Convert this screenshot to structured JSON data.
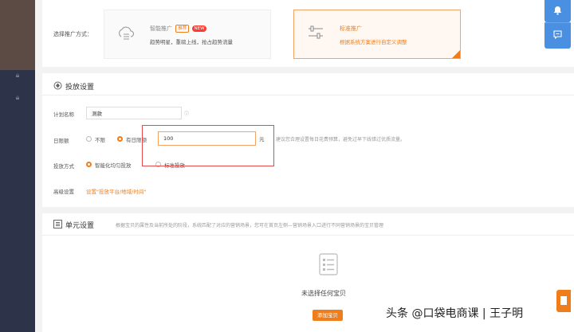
{
  "promotion": {
    "label": "选择推广方式：",
    "options": [
      {
        "title": "智能推广",
        "badge_recommend": "推荐",
        "badge_new": "NEW",
        "desc": "趋势明星，重磅上线，抢占趋势流量",
        "selected": false
      },
      {
        "title": "标准推广",
        "desc": "根据系统方案进行自定义调整",
        "selected": true
      }
    ]
  },
  "delivery": {
    "title": "投放设置",
    "plan_name_label": "计划名称",
    "plan_name_value": "测款",
    "daily_limit_label": "日限额",
    "no_limit_label": "不限",
    "has_limit_label": "有日限额",
    "daily_limit_value": "100",
    "unit": "元",
    "hint": "建议您合理设置每日花费预算，避免过早下线错过优质流量。",
    "method_label": "投放方式",
    "method_smart": "智能化均匀投放",
    "method_standard": "标准投放",
    "advanced_label": "高级设置",
    "advanced_link": "设置\"投放平台/地域/时间\""
  },
  "unit_settings": {
    "title": "单元设置",
    "desc": "根据宝贝的属性及当前所处的阶段，系统匹配了对应的营销场景，您可在首页左侧—营销场景入口进行不同营销场景的宝贝管理",
    "empty_text": "未选择任何宝贝",
    "add_button": "添加宝贝"
  },
  "watermark": "头条 @口袋电商课 | 王子明",
  "colors": {
    "accent": "#f07d1c",
    "sidebar": "#2d3449",
    "fab": "#4a90e2",
    "highlight": "#e24b4b"
  }
}
